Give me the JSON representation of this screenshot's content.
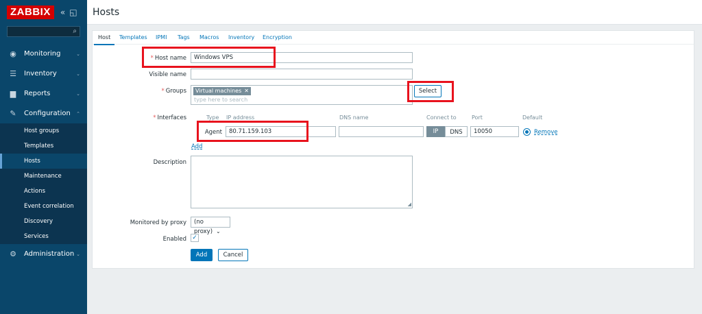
{
  "app": {
    "logo": "ZABBIX",
    "search_placeholder": ""
  },
  "sidebar": {
    "items": [
      {
        "label": "Monitoring",
        "icon": "eye-icon"
      },
      {
        "label": "Inventory",
        "icon": "list-icon"
      },
      {
        "label": "Reports",
        "icon": "bar-chart-icon"
      },
      {
        "label": "Configuration",
        "icon": "wrench-icon"
      },
      {
        "label": "Administration",
        "icon": "gear-icon"
      }
    ],
    "submenu": [
      "Host groups",
      "Templates",
      "Hosts",
      "Maintenance",
      "Actions",
      "Event correlation",
      "Discovery",
      "Services"
    ],
    "active_submenu": "Hosts"
  },
  "header": {
    "title": "Hosts"
  },
  "tabs": [
    "Host",
    "Templates",
    "IPMI",
    "Tags",
    "Macros",
    "Inventory",
    "Encryption"
  ],
  "form": {
    "host_name_label": "Host name",
    "host_name_value": "Windows VPS",
    "visible_name_label": "Visible name",
    "visible_name_value": "",
    "groups_label": "Groups",
    "group_chip": "Virtual machines",
    "groups_placeholder": "type here to search",
    "select_button": "Select",
    "interfaces_label": "Interfaces",
    "interface_headers": {
      "type": "Type",
      "ip": "IP address",
      "dns": "DNS name",
      "connect": "Connect to",
      "port": "Port",
      "default": "Default"
    },
    "interface_row": {
      "type": "Agent",
      "ip": "80.71.159.103",
      "dns": "",
      "connect_ip": "IP",
      "connect_dns": "DNS",
      "port": "10050",
      "remove": "Remove"
    },
    "add_link": "Add",
    "description_label": "Description",
    "proxy_label": "Monitored by proxy",
    "proxy_value": "(no proxy)",
    "enabled_label": "Enabled",
    "add_button": "Add",
    "cancel_button": "Cancel"
  },
  "colors": {
    "sidebar": "#0a466a",
    "accent": "#0275b8",
    "logo": "#d40000",
    "highlight": "#e8121d"
  }
}
